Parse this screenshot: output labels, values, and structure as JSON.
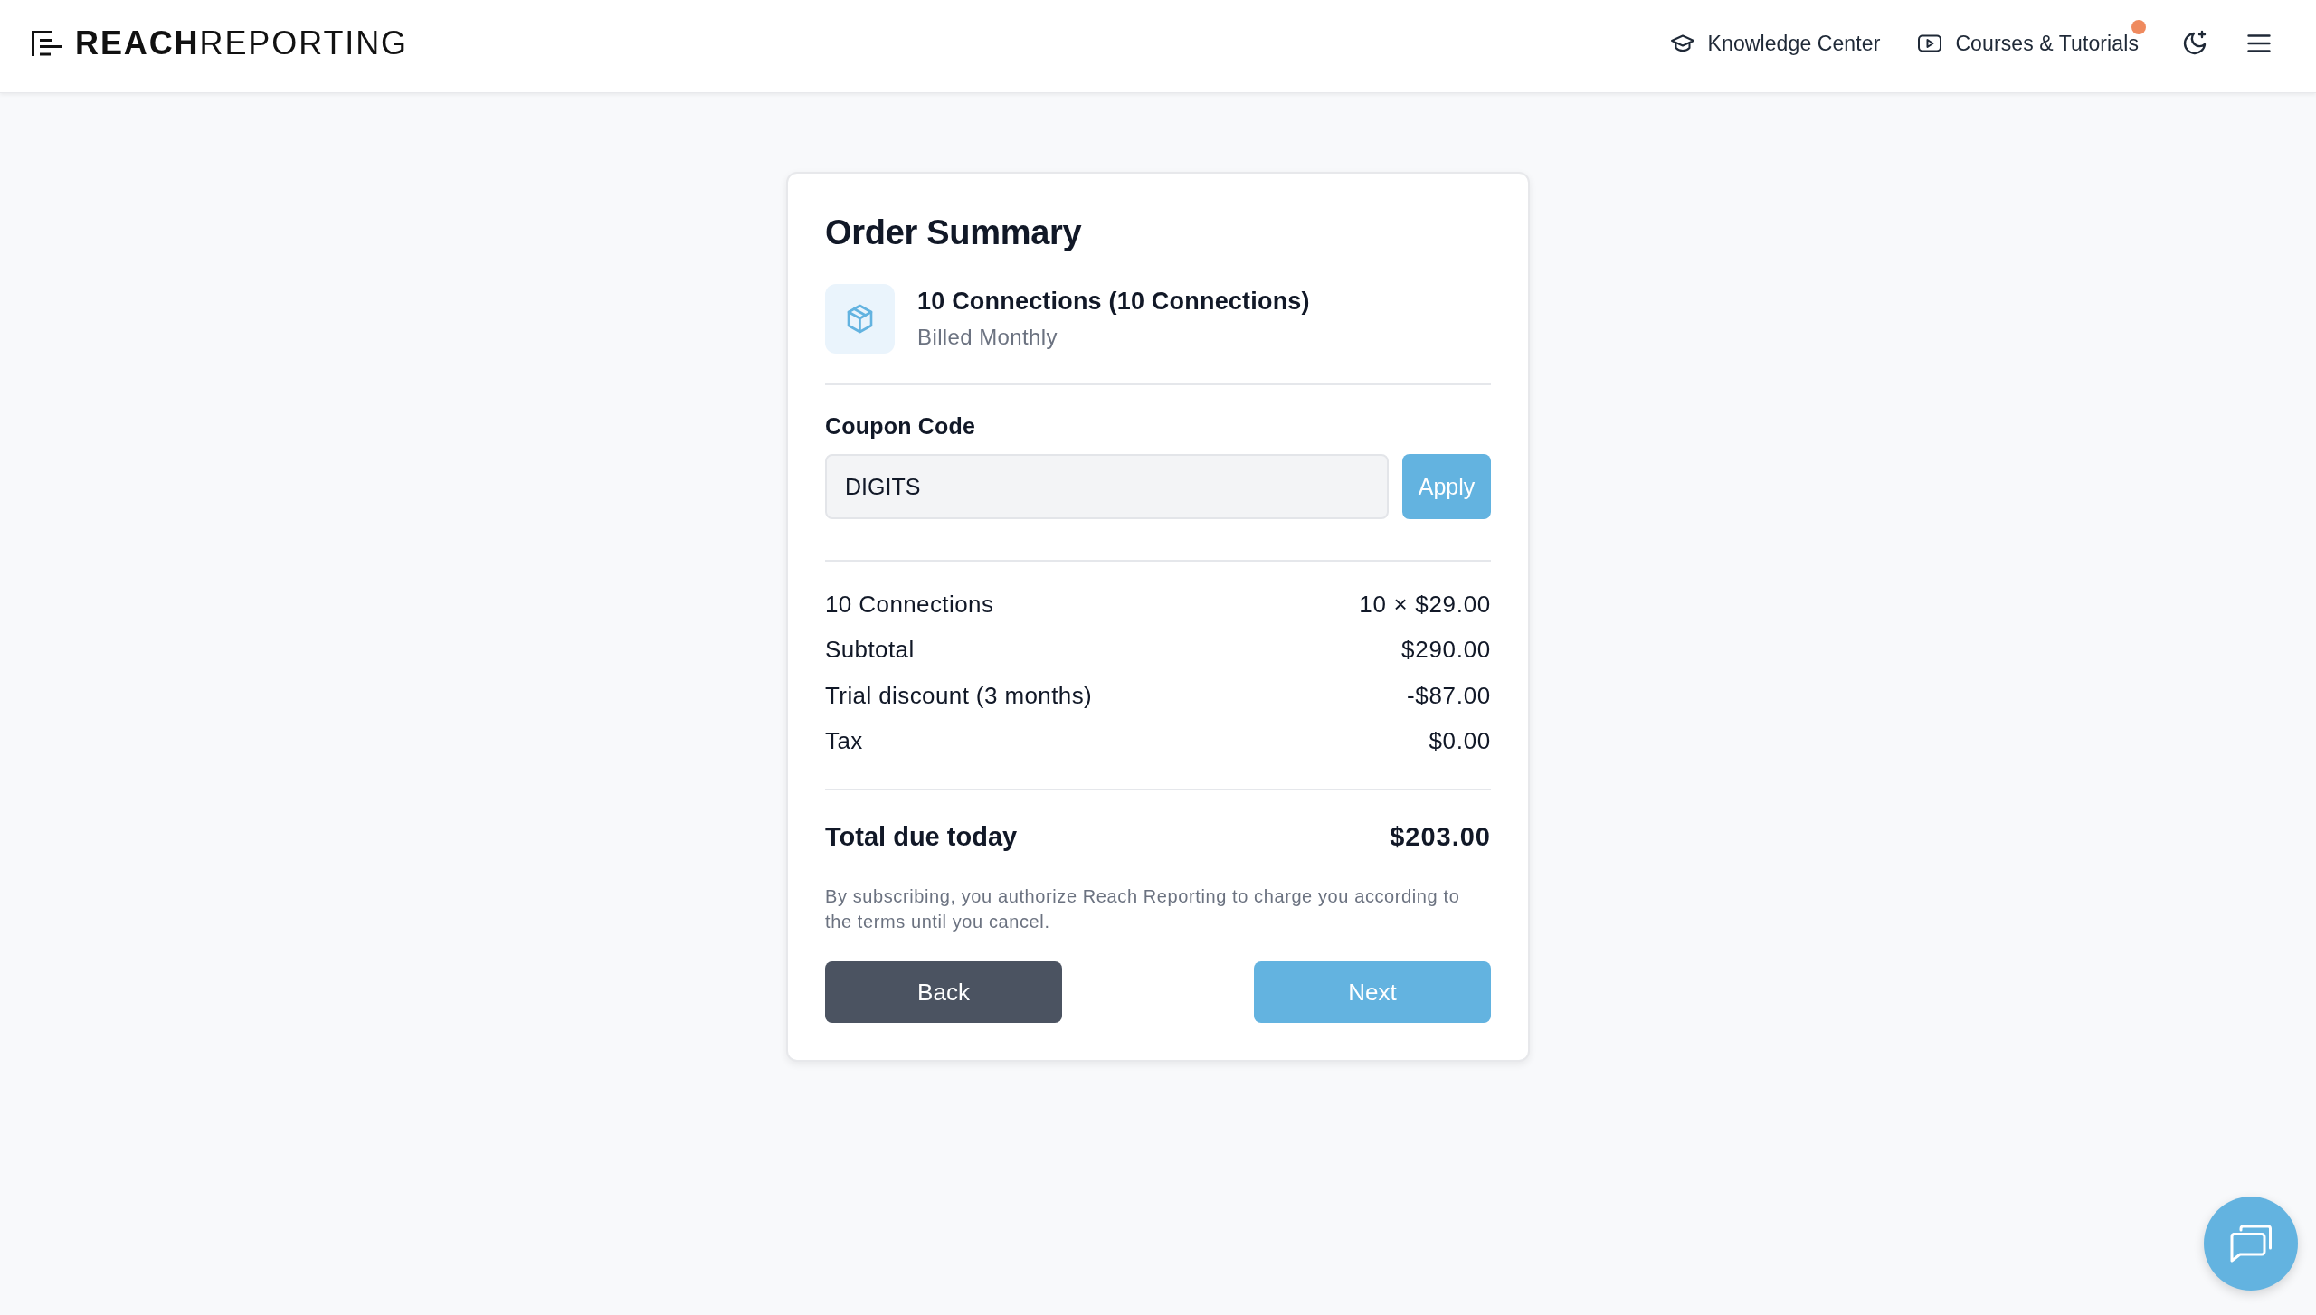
{
  "header": {
    "logo": "**REACH**REPORTING",
    "links": [
      {
        "label": "Knowledge Center",
        "notification": false
      },
      {
        "label": "Courses & Tutorials",
        "notification": true
      }
    ]
  },
  "order": {
    "title": "Order Summary",
    "product": {
      "name": "10 Connections (10 Connections)",
      "billing": "Billed Monthly"
    },
    "coupon": {
      "label": "Coupon Code",
      "value": "DIGITS",
      "button": "Apply"
    },
    "lines": [
      {
        "label": "10 Connections",
        "amount": "10 × $29.00"
      },
      {
        "label": "Subtotal",
        "amount": "$290.00"
      },
      {
        "label": "Trial discount (3 months)",
        "amount": "-$87.00"
      },
      {
        "label": "Tax",
        "amount": "$0.00"
      }
    ],
    "total": {
      "label": "Total due today",
      "amount": "$203.00"
    },
    "disclaimer": "By subscribing, you authorize Reach Reporting to charge you according to the terms until you cancel.",
    "buttons": [
      {
        "label": "Back",
        "kind": "secondary"
      },
      {
        "label": "Next",
        "kind": "primary"
      }
    ]
  }
}
